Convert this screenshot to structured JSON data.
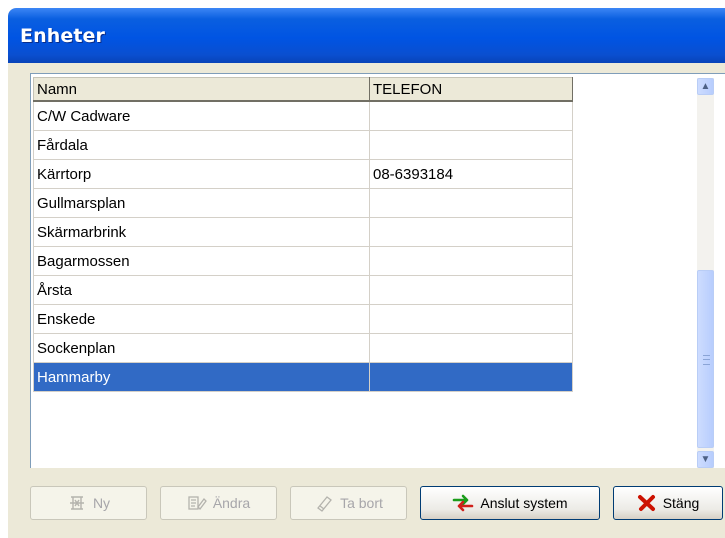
{
  "window": {
    "title": "Enheter"
  },
  "table": {
    "columns": [
      "Namn",
      "TELEFON"
    ],
    "rows": [
      {
        "namn": "C/W Cadware",
        "telefon": ""
      },
      {
        "namn": "Fårdala",
        "telefon": ""
      },
      {
        "namn": "Kärrtorp",
        "telefon": "08-6393184"
      },
      {
        "namn": "Gullmarsplan",
        "telefon": ""
      },
      {
        "namn": "Skärmarbrink",
        "telefon": ""
      },
      {
        "namn": "Bagarmossen",
        "telefon": ""
      },
      {
        "namn": "Årsta",
        "telefon": ""
      },
      {
        "namn": "Enskede",
        "telefon": ""
      },
      {
        "namn": "Sockenplan",
        "telefon": ""
      },
      {
        "namn": "Hammarby",
        "telefon": ""
      }
    ],
    "selected_row": "Hammarby"
  },
  "buttons": {
    "ny": "Ny",
    "andra": "Ändra",
    "ta_bort": "Ta bort",
    "anslut_system": "Anslut system",
    "stang": "Stäng"
  },
  "icons": {
    "ny": "new-record-icon",
    "andra": "edit-icon",
    "ta_bort": "eraser-icon",
    "anslut_system": "connect-arrows-icon",
    "stang": "close-x-icon"
  },
  "colors": {
    "titlebar": "#0054e3",
    "selection": "#316ac5",
    "connect_icon_green": "#1a9c1a",
    "connect_icon_red": "#d0201a",
    "close_icon_red": "#cc1100"
  }
}
